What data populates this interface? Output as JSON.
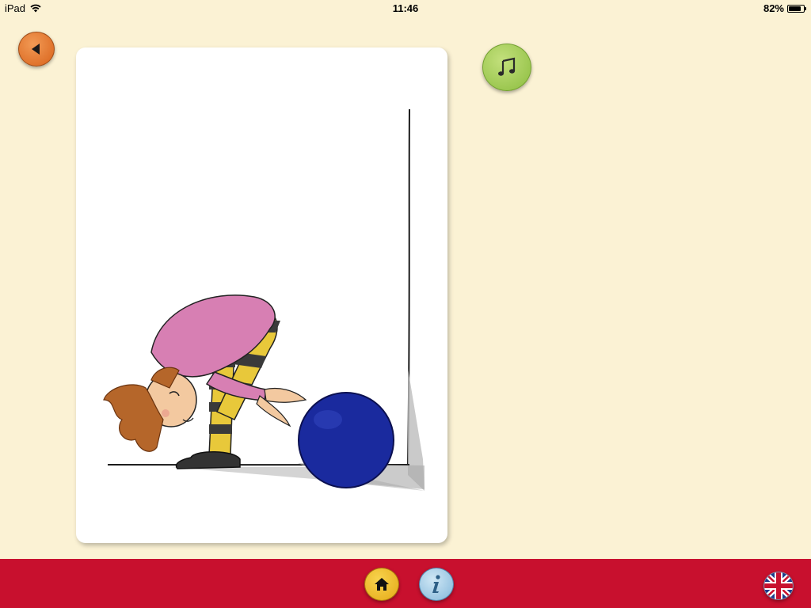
{
  "status_bar": {
    "device": "iPad",
    "time": "11:46",
    "battery": "82%",
    "battery_level": 0.82
  },
  "nav": {
    "back_icon": "triangle-left-icon",
    "music_icon": "music-note-icon"
  },
  "bottom_bar": {
    "home_icon": "house-icon",
    "info_icon": "info-icon",
    "language_icon": "uk-flag-icon"
  },
  "colors": {
    "background": "#fbf2d4",
    "bottom_bar": "#c8102e",
    "back_button": "#e0742a",
    "music_button": "#a6cf5a",
    "home_button": "#f0bd2b",
    "info_button": "#9dcae6",
    "ball": "#1a2a9e"
  }
}
